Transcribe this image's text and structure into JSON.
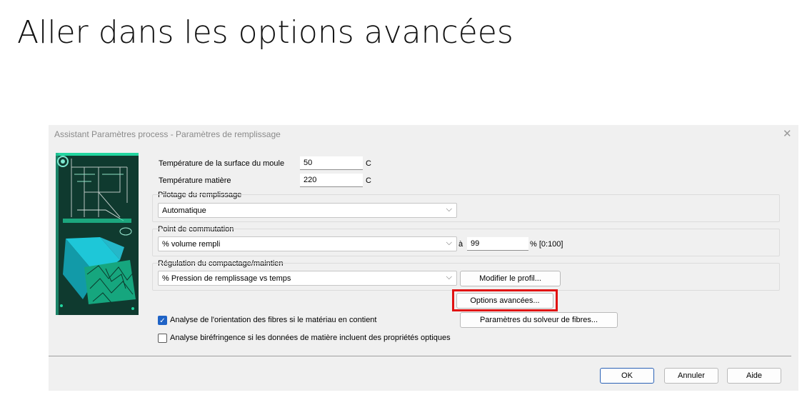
{
  "slide": {
    "title": "Aller dans les options avancées"
  },
  "dialog": {
    "title": "Assistant Paramètres process - Paramètres de remplissage",
    "close_icon": "close-icon",
    "mold_temp": {
      "label": "Température de la surface du moule",
      "value": "50",
      "unit": "C"
    },
    "melt_temp": {
      "label": "Température matière",
      "value": "220",
      "unit": "C"
    },
    "fill_control": {
      "label": "Pilotage du remplissage",
      "selected": "Automatique"
    },
    "switchover": {
      "label": "Point de commutation",
      "selected": "% volume rempli",
      "at_label": "à",
      "value": "99",
      "range": "% [0:100]"
    },
    "packing": {
      "label": "Régulation du compactage/maintien",
      "selected": "% Pression de remplissage vs temps",
      "edit_profile": "Modifier le profil..."
    },
    "advanced_options": "Options avancées...",
    "fiber": {
      "label": "Analyse de l'orientation des fibres si le matériau en contient",
      "checked": true,
      "solver_button": "Paramètres du solveur de fibres..."
    },
    "birefringence": {
      "label": "Analyse biréfringence si les données de matière incluent des propriétés optiques",
      "checked": false
    },
    "buttons": {
      "ok": "OK",
      "cancel": "Annuler",
      "help": "Aide"
    },
    "colors": {
      "highlight": "#e11212",
      "accent": "#1f63c6",
      "art_bg": "#0f3a2f",
      "art_green": "#22d6a0"
    }
  }
}
